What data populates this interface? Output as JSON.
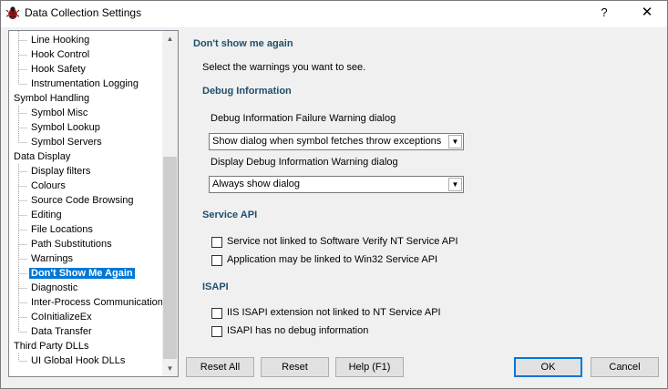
{
  "window": {
    "title": "Data Collection Settings",
    "help_label": "?",
    "close_label": "✕"
  },
  "tree": {
    "items": [
      {
        "label": "Line Hooking",
        "level": 1
      },
      {
        "label": "Hook Control",
        "level": 1
      },
      {
        "label": "Hook Safety",
        "level": 1
      },
      {
        "label": "Instrumentation Logging",
        "level": 1
      },
      {
        "label": "Symbol Handling",
        "level": 0
      },
      {
        "label": "Symbol Misc",
        "level": 1
      },
      {
        "label": "Symbol Lookup",
        "level": 1
      },
      {
        "label": "Symbol Servers",
        "level": 1
      },
      {
        "label": "Data Display",
        "level": 0
      },
      {
        "label": "Display filters",
        "level": 1
      },
      {
        "label": "Colours",
        "level": 1
      },
      {
        "label": "Source Code Browsing",
        "level": 1
      },
      {
        "label": "Editing",
        "level": 1
      },
      {
        "label": "File Locations",
        "level": 1
      },
      {
        "label": "Path Substitutions",
        "level": 1
      },
      {
        "label": "Warnings",
        "level": 1
      },
      {
        "label": "Don't Show Me Again",
        "level": 1,
        "selected": true
      },
      {
        "label": "Diagnostic",
        "level": 1
      },
      {
        "label": "Inter-Process Communication",
        "level": 1
      },
      {
        "label": "CoInitializeEx",
        "level": 1
      },
      {
        "label": "Data Transfer",
        "level": 1
      },
      {
        "label": "Third Party DLLs",
        "level": 0
      },
      {
        "label": "UI Global Hook DLLs",
        "level": 1
      }
    ],
    "scroll_up_icon": "▲",
    "scroll_down_icon": "▼"
  },
  "panel": {
    "title": "Don't show me again",
    "subtitle": "Select the warnings you want to see.",
    "debug": {
      "heading": "Debug Information",
      "failure_label": "Debug Information Failure Warning dialog",
      "failure_value": "Show dialog when symbol fetches throw exceptions",
      "display_label": "Display Debug Information Warning dialog",
      "display_value": "Always show dialog"
    },
    "service": {
      "heading": "Service API",
      "check1": "Service not linked to Software Verify NT Service API",
      "check2": "Application may be linked to Win32 Service API"
    },
    "isapi": {
      "heading": "ISAPI",
      "check1": "IIS ISAPI extension not linked to NT Service API",
      "check2": "ISAPI has no debug information"
    }
  },
  "buttons": {
    "reset_all": "Reset All",
    "reset": "Reset",
    "help": "Help (F1)",
    "ok": "OK",
    "cancel": "Cancel"
  },
  "colors": {
    "heading": "#1f4f6f",
    "selection": "#0078d7"
  }
}
